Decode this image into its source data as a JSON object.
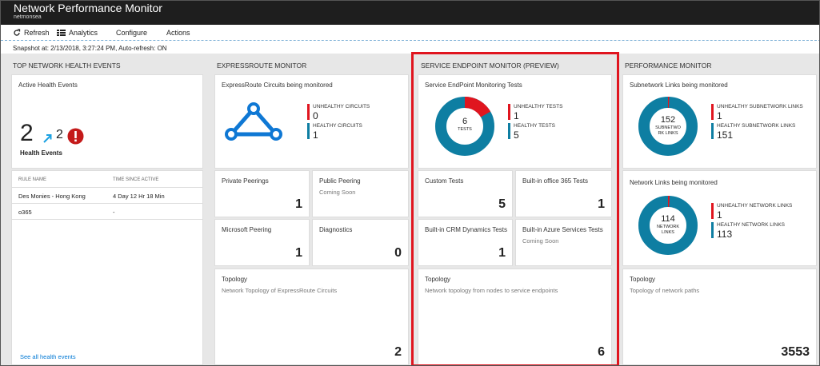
{
  "app": {
    "title": "Network Performance Monitor",
    "subtitle": "netmonsea"
  },
  "toolbar": {
    "refresh": "Refresh",
    "analytics": "Analytics",
    "configure": "Configure",
    "actions": "Actions"
  },
  "snapshot": "Snapshot at: 2/13/2018, 3:27:24 PM, Auto-refresh: ON",
  "colors": {
    "accent": "#0078d4",
    "unhealthy": "#e0151f",
    "healthy": "#0e7ea2",
    "highlight_border": "#e0151f"
  },
  "health": {
    "section_title": "TOP NETWORK HEALTH EVENTS",
    "tile_title": "Active Health Events",
    "count": "2",
    "trend_count": "2",
    "label": "Health Events",
    "col_rule": "RULE NAME",
    "col_time": "TIME SINCE ACTIVE",
    "rows": [
      {
        "rule": "Des Monies - Hong Kong",
        "time": "4 Day 12 Hr 18 Min"
      },
      {
        "rule": "o365",
        "time": "-"
      }
    ],
    "see_all": "See all health events"
  },
  "expressroute": {
    "section_title": "EXPRESSROUTE MONITOR",
    "circuits_title": "ExpressRoute Circuits being monitored",
    "unhealthy_label": "UNHEALTHY CIRCUITS",
    "unhealthy_value": "0",
    "healthy_label": "HEALTHY CIRCUITS",
    "healthy_value": "1",
    "private_title": "Private Peerings",
    "private_value": "1",
    "public_title": "Public Peering",
    "public_sub": "Coming Soon",
    "microsoft_title": "Microsoft Peering",
    "microsoft_value": "1",
    "diag_title": "Diagnostics",
    "diag_value": "0",
    "topo_title": "Topology",
    "topo_sub": "Network Topology of ExpressRoute Circuits",
    "topo_value": "2"
  },
  "endpoint": {
    "section_title": "SERVICE ENDPOINT MONITOR (PREVIEW)",
    "tests_title": "Service EndPoint Monitoring Tests",
    "donut_value": "6",
    "donut_label": "TESTS",
    "unhealthy_label": "UNHEALTHY TESTS",
    "unhealthy_value": "1",
    "healthy_label": "HEALTHY TESTS",
    "healthy_value": "5",
    "unhealthy_fraction": 0.1667,
    "custom_title": "Custom Tests",
    "custom_value": "5",
    "o365_title": "Built-in office 365 Tests",
    "o365_value": "1",
    "crm_title": "Built-in CRM Dynamics Tests",
    "crm_value": "1",
    "azure_title": "Built-in Azure Services Tests",
    "azure_sub": "Coming Soon",
    "topo_title": "Topology",
    "topo_sub": "Network topology from nodes to service endpoints",
    "topo_value": "6"
  },
  "performance": {
    "section_title": "PERFORMANCE MONITOR",
    "subnet_title": "Subnetwork Links being monitored",
    "subnet_donut_value": "152",
    "subnet_donut_label": "SUBNETWO RK LINKS",
    "subnet_unhealthy_label": "UNHEALTHY SUBNETWORK LINKS",
    "subnet_unhealthy_value": "1",
    "subnet_healthy_label": "HEALTHY SUBNETWORK LINKS",
    "subnet_healthy_value": "151",
    "subnet_unhealthy_fraction": 0.0066,
    "net_title": "Network Links being monitored",
    "net_donut_value": "114",
    "net_donut_label": "NETWORK LINKS",
    "net_unhealthy_label": "UNHEALTHY NETWORK LINKS",
    "net_unhealthy_value": "1",
    "net_healthy_label": "HEALTHY NETWORK LINKS",
    "net_healthy_value": "113",
    "net_unhealthy_fraction": 0.0088,
    "topo_title": "Topology",
    "topo_sub": "Topology of network paths",
    "topo_value": "3553"
  }
}
